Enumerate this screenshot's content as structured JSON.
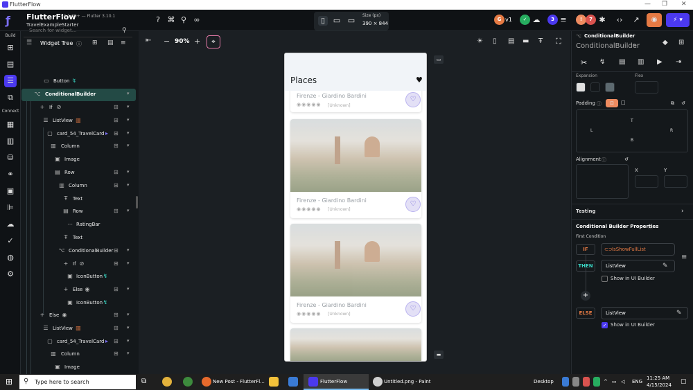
{
  "window": {
    "title": "FlutterFlow"
  },
  "topbar": {
    "brand": "FlutterFlow",
    "version": "v4.1.39+ — Flutter 3.10.1",
    "project": "TravelExampleStarter",
    "size_label": "Size (px)",
    "size_value": "390 × 844",
    "zoom": "90%",
    "version_badge": "v1",
    "badge_blue": "3",
    "badge_orange": "!",
    "badge_red": "7"
  },
  "rail": {
    "build_label": "Build",
    "connect_label": "Connect"
  },
  "tree": {
    "title": "Widget Tree",
    "search_placeholder": "Search for widget...",
    "rows": [
      {
        "label": "Button"
      },
      {
        "label": "ConditionalBuilder"
      },
      {
        "label": "If"
      },
      {
        "label": "ListView"
      },
      {
        "label": "card_54_TravelCard"
      },
      {
        "label": "Column"
      },
      {
        "label": "Image"
      },
      {
        "label": "Row"
      },
      {
        "label": "Column"
      },
      {
        "label": "Text"
      },
      {
        "label": "Row"
      },
      {
        "label": "RatingBar"
      },
      {
        "label": "Text"
      },
      {
        "label": "ConditionalBuilder"
      },
      {
        "label": "If"
      },
      {
        "label": "IconButton"
      },
      {
        "label": "Else"
      },
      {
        "label": "IconButton"
      },
      {
        "label": "Else"
      },
      {
        "label": "ListView"
      },
      {
        "label": "card_54_TravelCard"
      },
      {
        "label": "Column"
      },
      {
        "label": "Image"
      }
    ]
  },
  "phone": {
    "title": "Places",
    "cards": [
      {
        "name": "Firenze - Giardino Bardini",
        "rating": "[Unknown]"
      },
      {
        "name": "Firenze - Giardino Bardini",
        "rating": "[Unknown]"
      },
      {
        "name": "Firenze - Giardino Bardini",
        "rating": "[Unknown]"
      }
    ]
  },
  "panel": {
    "widget_type": "ConditionalBuilder",
    "widget_name": "ConditionalBuilder",
    "expansion": "Expansion",
    "flex": "Flex",
    "padding": "Padding",
    "pad_t": "T",
    "pad_l": "L",
    "pad_r": "R",
    "pad_b": "B",
    "alignment": "Alignment",
    "x_label": "X",
    "y_label": "Y",
    "testing": "Testing",
    "cb_props": "Conditional Builder Properties",
    "first_condition": "First Condition",
    "if_label": "IF",
    "if_value": "IsShowFullList",
    "then_label": "THEN",
    "then_value": "ListView",
    "show_ui": "Show in UI Builder",
    "else_label": "ELSE",
    "else_value": "ListView",
    "show_ui2": "Show in UI Builder"
  },
  "taskbar": {
    "search": "Type here to search",
    "item1": "New Post - FlutterFl...",
    "item2": "FlutterFlow",
    "item3": "Untitled.png - Paint",
    "desktop": "Desktop",
    "lang": "ENG",
    "time": "11:25 AM",
    "date": "4/15/2024"
  }
}
